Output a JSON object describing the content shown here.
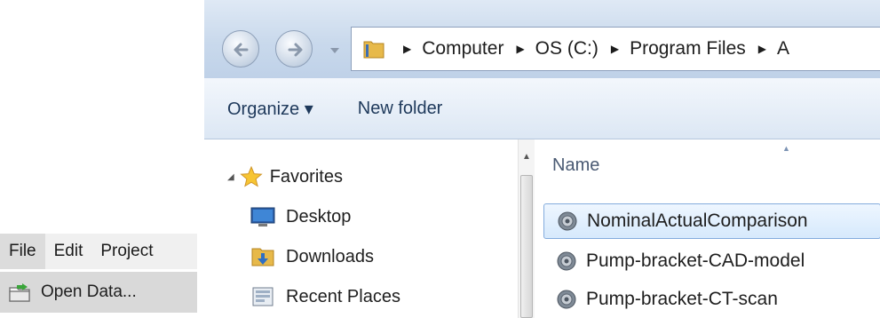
{
  "app_menu": {
    "menubar": [
      "File",
      "Edit",
      "Project"
    ],
    "dropdown_item": "Open Data...",
    "dropdown_icon": "open-folder-icon"
  },
  "explorer": {
    "path": [
      "Computer",
      "OS (C:)",
      "Program Files",
      "A"
    ],
    "toolbar": {
      "organize": "Organize ▾",
      "new_folder": "New folder"
    },
    "nav_pane": {
      "favorites": "Favorites",
      "items": [
        {
          "label": "Desktop",
          "icon": "desktop-icon"
        },
        {
          "label": "Downloads",
          "icon": "downloads-folder-icon"
        },
        {
          "label": "Recent Places",
          "icon": "recent-places-icon"
        }
      ]
    },
    "file_list": {
      "column": "Name",
      "files": [
        {
          "name": "NominalActualComparison",
          "selected": true
        },
        {
          "name": "Pump-bracket-CAD-model",
          "selected": false
        },
        {
          "name": "Pump-bracket-CT-scan",
          "selected": false
        }
      ]
    }
  },
  "colors": {
    "selection_border": "#84acdd",
    "toolbar_text": "#1e395b",
    "header_gradient_top": "#dfe9f5"
  }
}
